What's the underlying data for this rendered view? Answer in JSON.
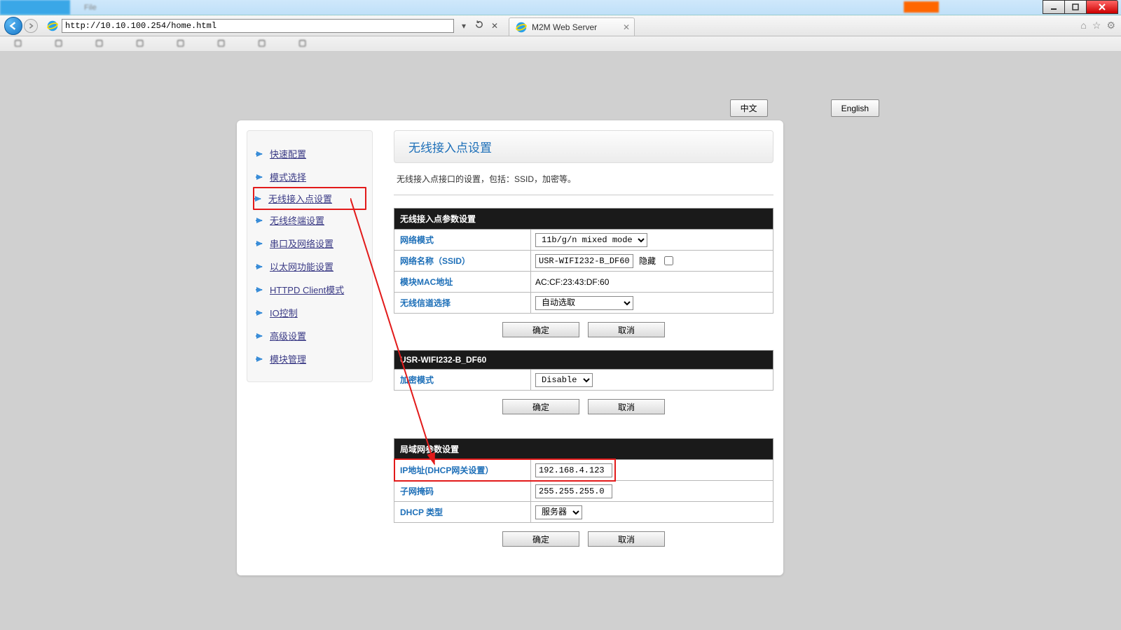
{
  "browser": {
    "url": "http://10.10.100.254/home.html",
    "tab_title": "M2M Web Server",
    "addr_controls": [
      "▾",
      "↻",
      "✕"
    ],
    "right_icons": [
      "⌂",
      "☆",
      "⚙"
    ]
  },
  "lang": {
    "cn": "中文",
    "en": "English"
  },
  "sidebar": {
    "items": [
      {
        "label": "快速配置"
      },
      {
        "label": "模式选择"
      },
      {
        "label": "无线接入点设置",
        "hl": true
      },
      {
        "label": "无线终端设置"
      },
      {
        "label": "串口及网络设置"
      },
      {
        "label": "以太网功能设置"
      },
      {
        "label": "HTTPD Client模式"
      },
      {
        "label": "IO控制"
      },
      {
        "label": "高级设置"
      },
      {
        "label": "模块管理"
      }
    ]
  },
  "main": {
    "title": "无线接入点设置",
    "desc": "无线接入点接口的设置，包括：SSID，加密等。",
    "sect_ap": {
      "head": "无线接入点参数设置",
      "rows": {
        "net_mode": {
          "label": "网络模式",
          "value": "11b/g/n mixed mode"
        },
        "ssid": {
          "label": "网络名称（SSID）",
          "value": "USR-WIFI232-B_DF60",
          "hide_label": "隐藏"
        },
        "mac": {
          "label": "模块MAC地址",
          "value": "AC:CF:23:43:DF:60"
        },
        "channel": {
          "label": "无线信道选择",
          "value": "自动选取"
        }
      }
    },
    "sect_sec": {
      "head": "USR-WIFI232-B_DF60",
      "enc": {
        "label": "加密模式",
        "value": "Disable"
      }
    },
    "sect_lan": {
      "head": "局域网参数设置",
      "ip": {
        "label": "IP地址(DHCP网关设置）",
        "value": "192.168.4.123"
      },
      "mask": {
        "label": "子网掩码",
        "value": "255.255.255.0"
      },
      "dhcp": {
        "label": "DHCP 类型",
        "value": "服务器"
      }
    },
    "buttons": {
      "ok": "确定",
      "cancel": "取消"
    }
  }
}
